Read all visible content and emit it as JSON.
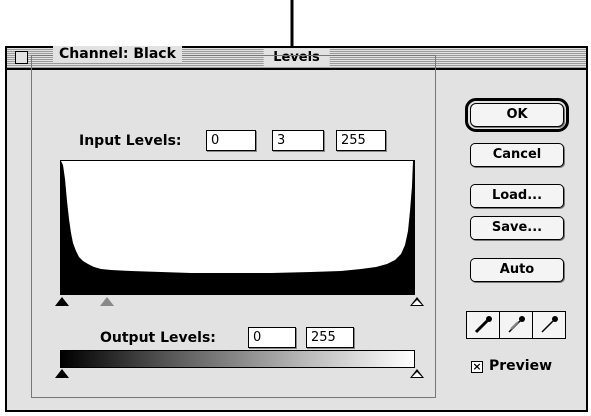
{
  "window": {
    "title": "Levels"
  },
  "channel": {
    "label": "Channel:",
    "value": "Black"
  },
  "input_levels": {
    "label": "Input Levels:",
    "values": [
      "0",
      "3",
      "255"
    ]
  },
  "output_levels": {
    "label": "Output Levels:",
    "values": [
      "0",
      "255"
    ]
  },
  "buttons": {
    "ok": "OK",
    "cancel": "Cancel",
    "load": "Load...",
    "save": "Save...",
    "auto": "Auto"
  },
  "eyedroppers": [
    "black-eyedropper-icon",
    "gray-eyedropper-icon",
    "white-eyedropper-icon"
  ],
  "preview": {
    "label": "Preview",
    "checked": true,
    "mark": "×"
  },
  "annotation": {
    "icon": "down-arrow-icon"
  },
  "colors": {
    "dialog_bg": "#e2e2e2",
    "histogram": "#000000"
  }
}
